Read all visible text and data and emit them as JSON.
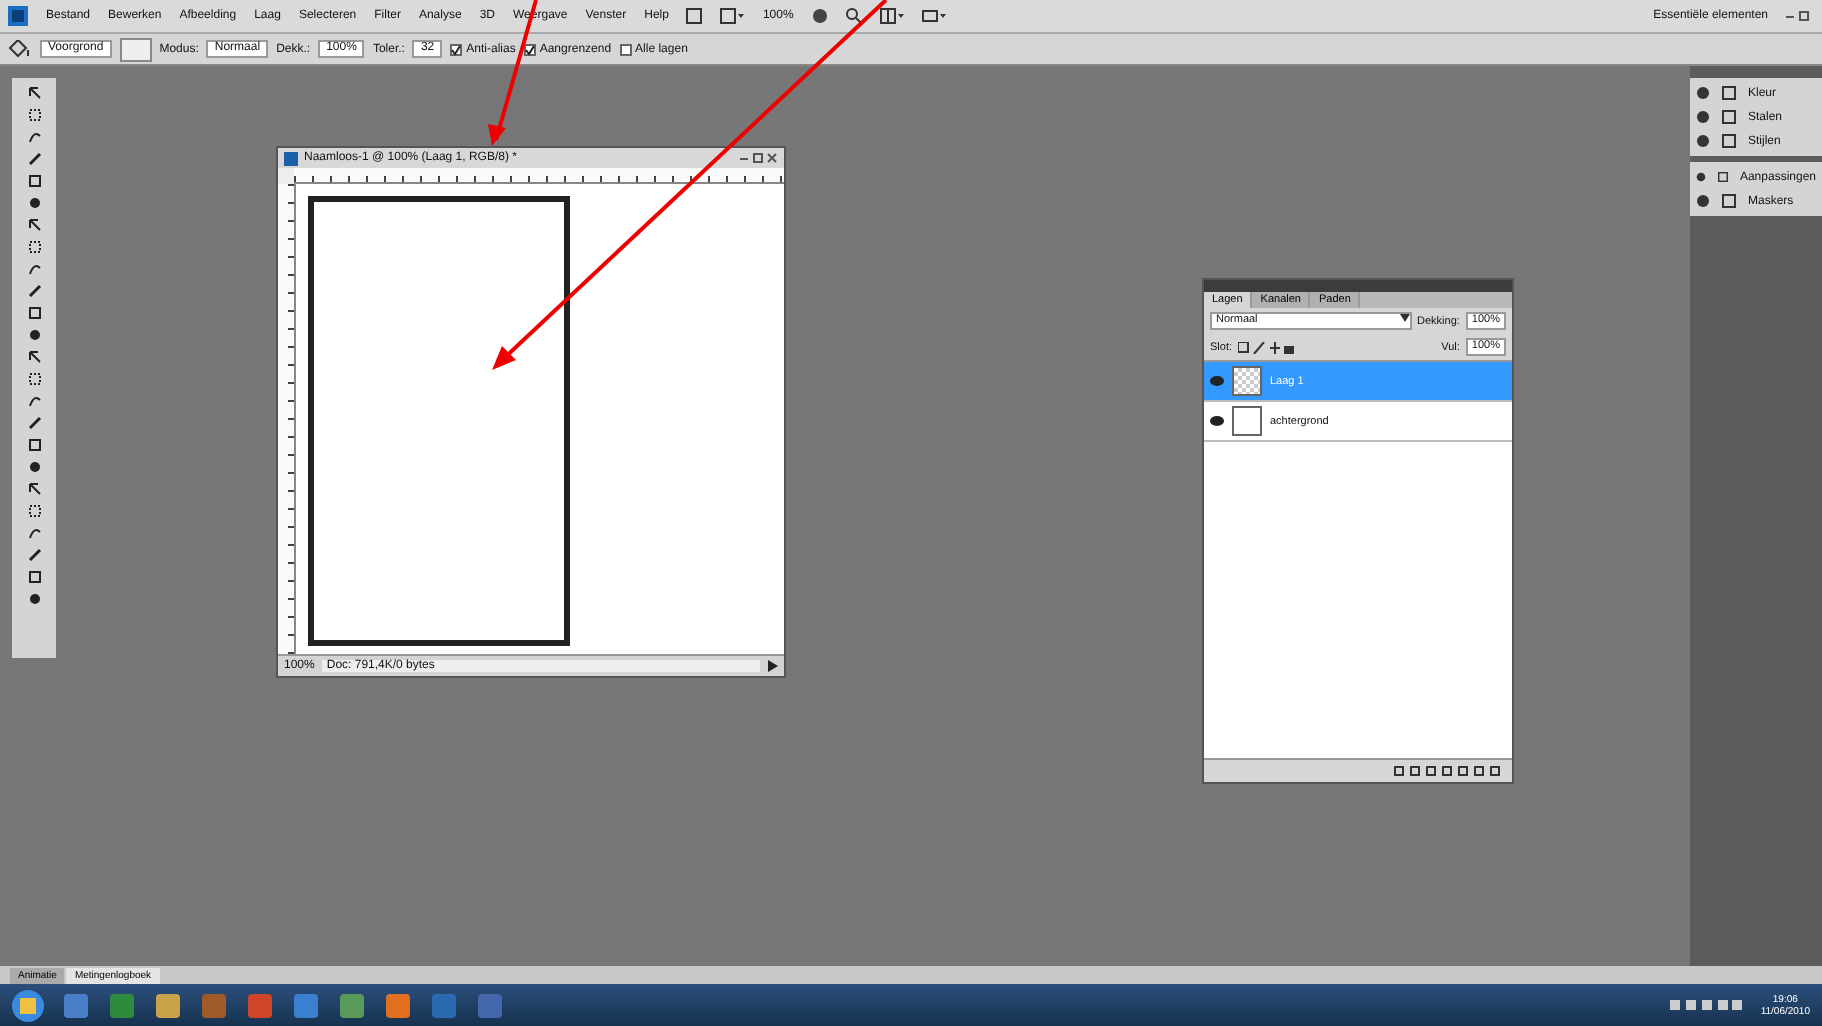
{
  "menu": [
    "Bestand",
    "Bewerken",
    "Afbeelding",
    "Laag",
    "Selecteren",
    "Filter",
    "Analyse",
    "3D",
    "Weergave",
    "Venster",
    "Help"
  ],
  "app_bar": {
    "zoom": "100%"
  },
  "workspace": "Essentiële elementen",
  "options_bar": {
    "preset": "Voorgrond",
    "mode_label": "Modus:",
    "mode": "Normaal",
    "opacity_label": "Dekk.:",
    "opacity": "100%",
    "tolerance_label": "Toler.:",
    "tolerance": "32",
    "checkboxes": [
      {
        "label": "Anti-alias",
        "checked": true
      },
      {
        "label": "Aangrenzend",
        "checked": true
      },
      {
        "label": "Alle lagen",
        "checked": false
      }
    ]
  },
  "document": {
    "title": "Naamloos-1 @ 100% (Laag 1, RGB/8) *",
    "zoom": "100%",
    "status": "Doc: 791,4K/0 bytes"
  },
  "layers_panel": {
    "tabs": [
      {
        "label": "Lagen",
        "selected": true
      },
      {
        "label": "Kanalen",
        "selected": false
      },
      {
        "label": "Paden",
        "selected": false
      }
    ],
    "blend_mode": "Normaal",
    "opacity_label": "Dekking:",
    "opacity": "100%",
    "lock_label": "Slot:",
    "fill_label": "Vul:",
    "fill": "100%",
    "layers": [
      {
        "name": "Laag 1",
        "selected": true,
        "visible": true,
        "kind": "transparent"
      },
      {
        "name": "achtergrond",
        "selected": false,
        "visible": true,
        "kind": "white"
      }
    ]
  },
  "dock": [
    {
      "items": [
        "Kleur",
        "Stalen",
        "Stijlen"
      ]
    },
    {
      "items": [
        "Aanpassingen",
        "Maskers"
      ]
    }
  ],
  "bottom_tabs": [
    {
      "label": "Animatie",
      "selected": false
    },
    {
      "label": "Metingenlogboek",
      "selected": true
    }
  ],
  "taskbar": {
    "time": "19:06",
    "date": "11/06/2010"
  }
}
